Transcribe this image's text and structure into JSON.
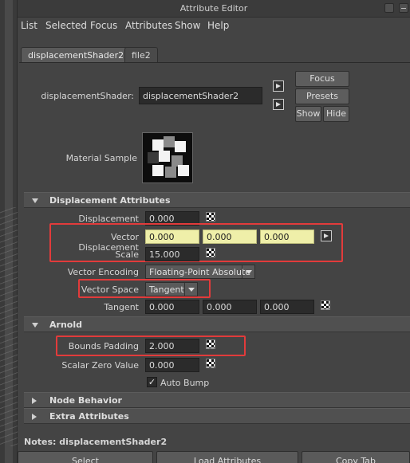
{
  "window": {
    "title": "Attribute Editor"
  },
  "menu": [
    "List",
    "Selected",
    "Focus",
    "Attributes",
    "Show",
    "Help"
  ],
  "tabs": [
    "displacementShader2",
    "file2"
  ],
  "header": {
    "node_label": "displacementShader:",
    "node_value": "displacementShader2",
    "focus": "Focus",
    "presets": "Presets",
    "show": "Show",
    "hide": "Hide",
    "sample_label": "Material Sample"
  },
  "sections": {
    "displacement": "Displacement Attributes",
    "arnold": "Arnold",
    "node_behavior": "Node Behavior",
    "extra": "Extra Attributes"
  },
  "attrs": {
    "displacement_label": "Displacement",
    "displacement_value": "0.000",
    "vector_disp_label": "Vector Displacement",
    "vector_disp_x": "0.000",
    "vector_disp_y": "0.000",
    "vector_disp_z": "0.000",
    "scale_label": "Scale",
    "scale_value": "15.000",
    "vector_encoding_label": "Vector Encoding",
    "vector_encoding_value": "Floating-Point Absolute",
    "vector_space_label": "Vector Space",
    "vector_space_value": "Tangent",
    "tangent_label": "Tangent",
    "tangent_x": "0.000",
    "tangent_y": "0.000",
    "tangent_z": "0.000",
    "bounds_padding_label": "Bounds Padding",
    "bounds_padding_value": "2.000",
    "scalar_zero_label": "Scalar Zero Value",
    "scalar_zero_value": "0.000",
    "auto_bump_label": "Auto Bump",
    "auto_bump_check": "✓"
  },
  "notes": "Notes: displacementShader2",
  "bottom": [
    "Select",
    "Load Attributes",
    "Copy Tab"
  ],
  "colors": {
    "highlight_field": "#efefa9",
    "annotation": "#e23b3b"
  }
}
